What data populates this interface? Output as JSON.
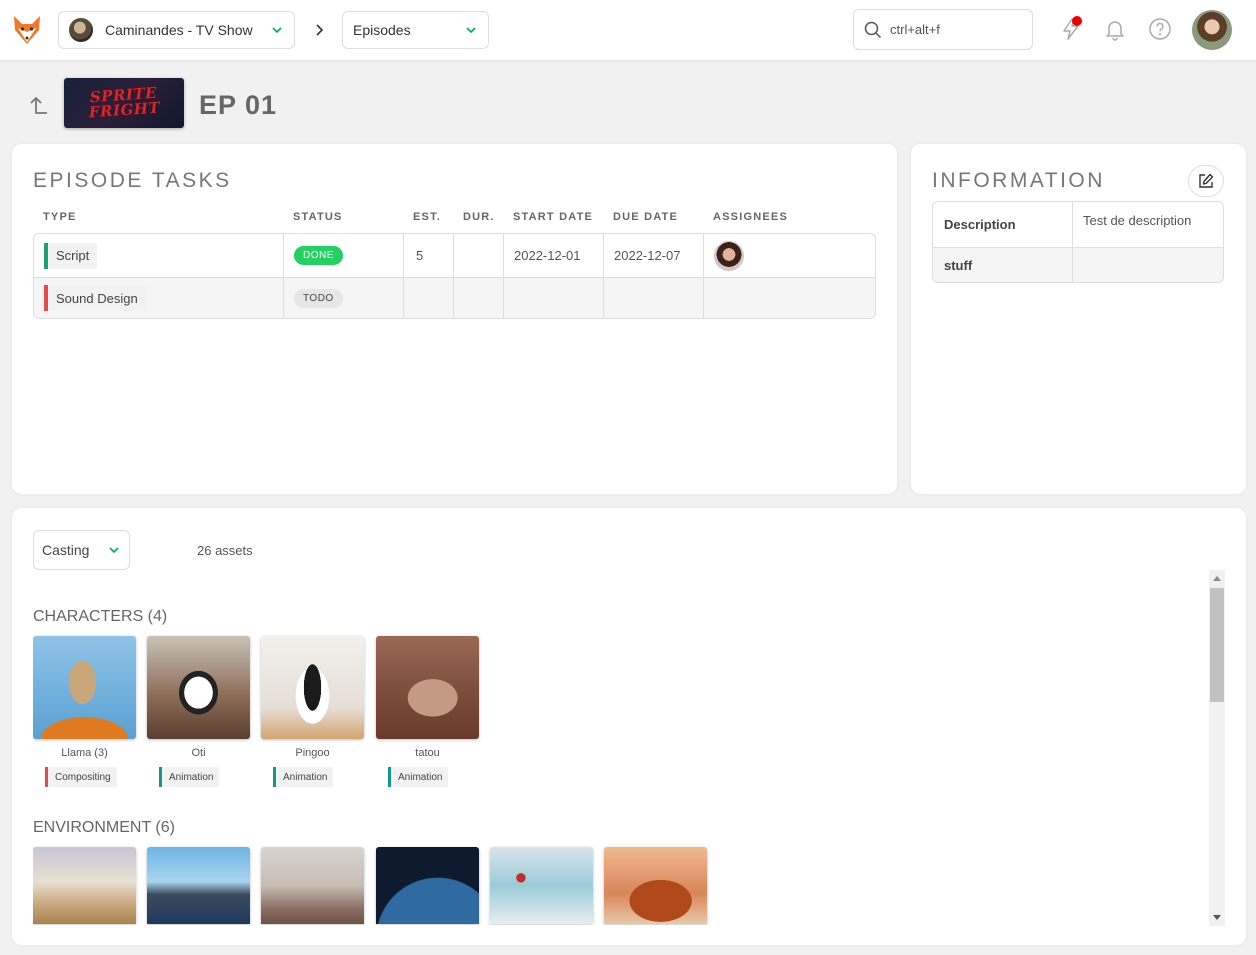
{
  "topbar": {
    "project": "Caminandes - TV Show",
    "section": "Episodes",
    "search_placeholder": "ctrl+alt+f"
  },
  "header": {
    "episode_thumb_text": "SPRITE FRIGHT",
    "episode_title": "EP 01"
  },
  "tasks": {
    "title": "EPISODE TASKS",
    "columns": [
      "TYPE",
      "STATUS",
      "EST.",
      "DUR.",
      "START DATE",
      "DUE DATE",
      "ASSIGNEES"
    ],
    "rows": [
      {
        "type": "Script",
        "type_color": "#22a06b",
        "status": "DONE",
        "est": "5",
        "dur": "",
        "start": "2022-12-01",
        "due": "2022-12-07"
      },
      {
        "type": "Sound Design",
        "type_color": "#e84a4a",
        "status": "TODO",
        "est": "",
        "dur": "",
        "start": "",
        "due": ""
      }
    ]
  },
  "info": {
    "title": "INFORMATION",
    "rows": [
      {
        "key": "Description",
        "value": "Test de description"
      },
      {
        "key": "stuff",
        "value": ""
      }
    ]
  },
  "casting": {
    "selector": "Casting",
    "asset_count": "26 assets",
    "characters_title": "CHARACTERS (4)",
    "characters": [
      {
        "name": "Llama (3)",
        "task": "Compositing",
        "task_color": "#e84a4a"
      },
      {
        "name": "Oti",
        "task": "Animation",
        "task_color": "#119a8c"
      },
      {
        "name": "Pingoo",
        "task": "Animation",
        "task_color": "#119a8c"
      },
      {
        "name": "tatou",
        "task": "Animation",
        "task_color": "#119a8c"
      }
    ],
    "environment_title": "ENVIRONMENT (6)"
  },
  "colors": {
    "accent_green": "#22d160",
    "chevron_green": "#00b242",
    "notification_red": "#e00000"
  }
}
